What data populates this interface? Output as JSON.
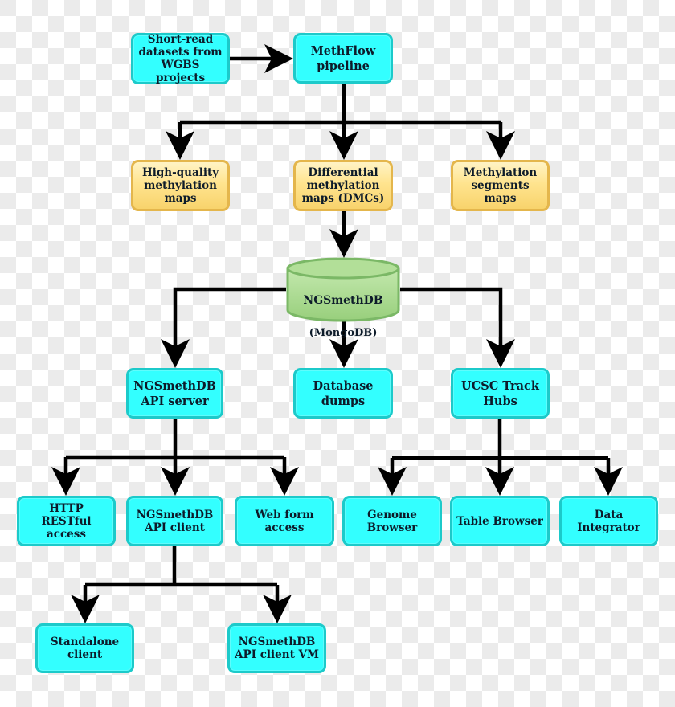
{
  "diagram": {
    "type": "flowchart",
    "colors": {
      "process_fill": "#33ffff",
      "process_border": "#1ccaca",
      "output_fill": "#ffe48f",
      "output_border": "#e4b64c",
      "database_fill": "#a9d98f",
      "database_border": "#7bb866",
      "connector": "#000000"
    },
    "nodes": {
      "short_read": "Short-read\ndatasets from\nWGBS projects",
      "methflow": "MethFlow\npipeline",
      "high_quality_maps": "High-quality\nmethylation\nmaps",
      "differential_maps": "Differential\nmethylation\nmaps (DMCs)",
      "segments_maps": "Methylation\nsegments maps",
      "database": {
        "title": "NGSmethDB",
        "subtitle": "(MongoDB)"
      },
      "api_server": "NGSmethDB\nAPI server",
      "database_dumps": "Database\ndumps",
      "ucsc_track_hubs": "UCSC Track\nHubs",
      "http_restful": "HTTP RESTful\naccess",
      "api_client": "NGSmethDB\nAPI client",
      "web_form": "Web form\naccess",
      "genome_browser": "Genome\nBrowser",
      "table_browser": "Table Browser",
      "data_integrator": "Data\nIntegrator",
      "standalone_client": "Standalone\nclient",
      "api_client_vm": "NGSmethDB\nAPI client VM"
    },
    "edges": [
      [
        "short_read",
        "methflow"
      ],
      [
        "methflow",
        "high_quality_maps"
      ],
      [
        "methflow",
        "differential_maps"
      ],
      [
        "methflow",
        "segments_maps"
      ],
      [
        "differential_maps",
        "database"
      ],
      [
        "database",
        "api_server"
      ],
      [
        "database",
        "database_dumps"
      ],
      [
        "database",
        "ucsc_track_hubs"
      ],
      [
        "api_server",
        "http_restful"
      ],
      [
        "api_server",
        "api_client"
      ],
      [
        "api_server",
        "web_form"
      ],
      [
        "ucsc_track_hubs",
        "genome_browser"
      ],
      [
        "ucsc_track_hubs",
        "table_browser"
      ],
      [
        "ucsc_track_hubs",
        "data_integrator"
      ],
      [
        "api_client",
        "standalone_client"
      ],
      [
        "api_client",
        "api_client_vm"
      ]
    ]
  }
}
